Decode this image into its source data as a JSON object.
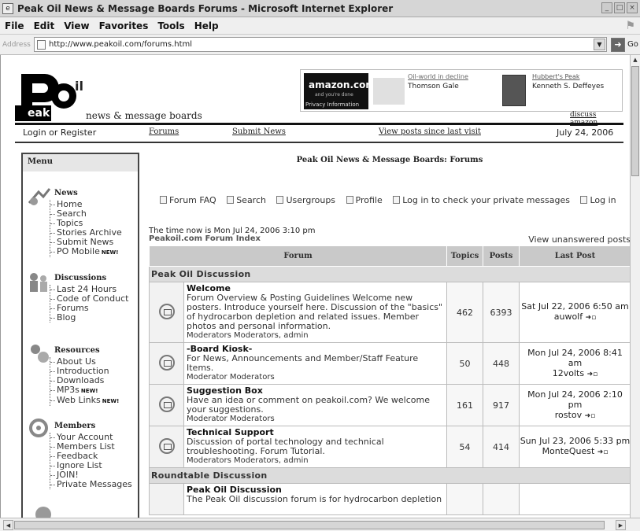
{
  "window": {
    "title": "Peak Oil News & Message Boards Forums - Microsoft Internet Explorer",
    "menu": [
      "File",
      "Edit",
      "View",
      "Favorites",
      "Tools",
      "Help"
    ],
    "address_label": "Address",
    "url": "http://www.peakoil.com/forums.html",
    "go_label": "Go"
  },
  "header": {
    "logo_letters": "PO",
    "logo_il": "il",
    "logo_eak": "eak",
    "logo_tagline": "news & message boards",
    "amazon": {
      "brand": "amazon.com",
      "sub": "and you're done",
      "privacy": "Privacy Information",
      "book1_title": "Oil-world in decline",
      "book1_author": "Thomson Gale",
      "book2_title": "Hubbert's Peak",
      "book2_author": "Kenneth S. Deffeyes",
      "discuss": "discuss amazon"
    }
  },
  "nav": {
    "login": "Login or Register",
    "forums": "Forums",
    "submit_news": "Submit News",
    "view_posts": "View posts since last visit",
    "date": "July 24, 2006"
  },
  "menu": {
    "title": "Menu",
    "sections": [
      {
        "head": "News",
        "items": [
          "Home",
          "Search",
          "Topics",
          "Stories Archive",
          "Submit News",
          "PO Mobile"
        ]
      },
      {
        "head": "Discussions",
        "items": [
          "Last 24 Hours",
          "Code of Conduct",
          "Forums",
          "Blog"
        ]
      },
      {
        "head": "Resources",
        "items": [
          "About Us",
          "Introduction",
          "Downloads",
          "MP3s",
          "Web Links"
        ]
      },
      {
        "head": "Members",
        "items": [
          "Your Account",
          "Members List",
          "Feedback",
          "Ignore List",
          "JOIN!",
          "Private Messages"
        ]
      }
    ],
    "new_badge": "NEW!"
  },
  "forum": {
    "page_title": "Peak Oil News & Message Boards: Forums",
    "toolbar": [
      "Forum FAQ",
      "Search",
      "Usergroups",
      "Profile",
      "Log in to check your private messages",
      "Log in"
    ],
    "time_now": "The time now is Mon Jul 24, 2006 3:10 pm",
    "index_title": "Peakoil.com Forum Index",
    "unanswered": "View unanswered posts",
    "columns": [
      "Forum",
      "Topics",
      "Posts",
      "Last Post"
    ],
    "categories": [
      {
        "name": "Peak Oil Discussion",
        "forums": [
          {
            "title": "Welcome",
            "desc": "Forum Overview & Posting Guidelines Welcome new posters. Introduce yourself here. Discussion of the \"basics\" of hydrocarbon depletion and related issues. Member photos and personal information.",
            "mods": "Moderators Moderators, admin",
            "topics": "462",
            "posts": "6393",
            "last_date": "Sat Jul 22, 2006 6:50 am",
            "last_user": "auwolf"
          },
          {
            "title": "-Board Kiosk-",
            "desc": "For News, Announcements and Member/Staff Feature Items.",
            "mods": "Moderator Moderators",
            "topics": "50",
            "posts": "448",
            "last_date": "Mon Jul 24, 2006 8:41 am",
            "last_user": "12volts"
          },
          {
            "title": "Suggestion Box",
            "desc": "Have an idea or comment on peakoil.com? We welcome your suggestions.",
            "mods": "Moderator Moderators",
            "topics": "161",
            "posts": "917",
            "last_date": "Mon Jul 24, 2006 2:10 pm",
            "last_user": "rostov"
          },
          {
            "title": "Technical Support",
            "desc": "Discussion of portal technology and technical troubleshooting. Forum Tutorial.",
            "mods": "Moderators Moderators, admin",
            "topics": "54",
            "posts": "414",
            "last_date": "Sun Jul 23, 2006 5:33 pm",
            "last_user": "MonteQuest"
          }
        ]
      },
      {
        "name": "Roundtable Discussion",
        "forums": [
          {
            "title": "Peak Oil Discussion",
            "desc": "The Peak Oil discussion forum is for hydrocarbon depletion",
            "mods": "",
            "topics": "",
            "posts": "",
            "last_date": "",
            "last_user": ""
          }
        ]
      }
    ]
  }
}
